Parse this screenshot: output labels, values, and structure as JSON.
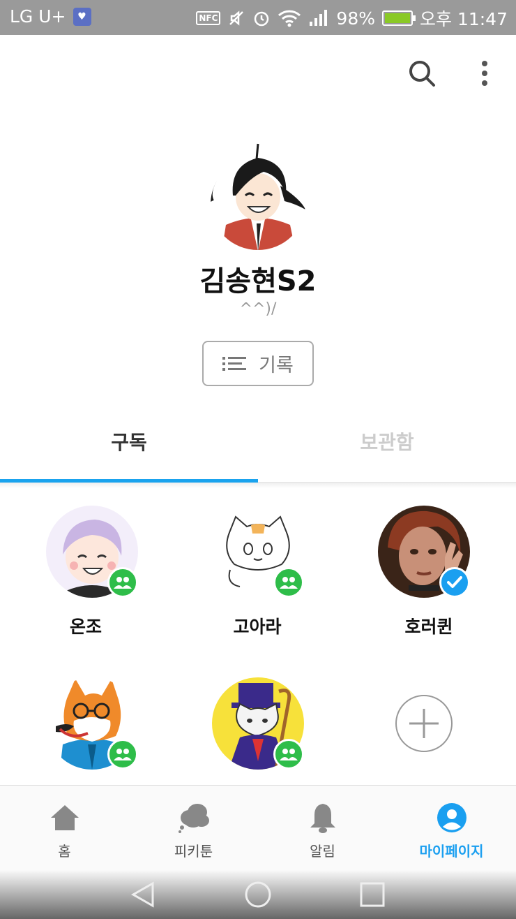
{
  "status_bar": {
    "carrier": "LG U+",
    "nfc_label": "NFC",
    "battery": "98%",
    "time": "오후 11:47"
  },
  "header": {
    "search_icon": "search-icon",
    "more_icon": "more-vertical-icon"
  },
  "profile": {
    "name": "김송현S2",
    "bio": "^^)/",
    "record_button": "기록"
  },
  "tabs": [
    {
      "label": "구독",
      "active": true
    },
    {
      "label": "보관함",
      "active": false
    }
  ],
  "subscriptions": [
    {
      "name": "온조",
      "badge": "group"
    },
    {
      "name": "고아라",
      "badge": "group"
    },
    {
      "name": "호러퀸",
      "badge": "verified"
    },
    {
      "name": "",
      "badge": "group"
    },
    {
      "name": "",
      "badge": "group"
    }
  ],
  "bottom_nav": [
    {
      "label": "홈",
      "icon": "home-icon",
      "active": false
    },
    {
      "label": "피키툰",
      "icon": "cloud-icon",
      "active": false
    },
    {
      "label": "알림",
      "icon": "bell-icon",
      "active": false
    },
    {
      "label": "마이페이지",
      "icon": "person-icon",
      "active": true
    }
  ],
  "colors": {
    "accent": "#1a9ff0",
    "group_badge": "#2ebd49",
    "status_bar": "#9a9a9a"
  }
}
